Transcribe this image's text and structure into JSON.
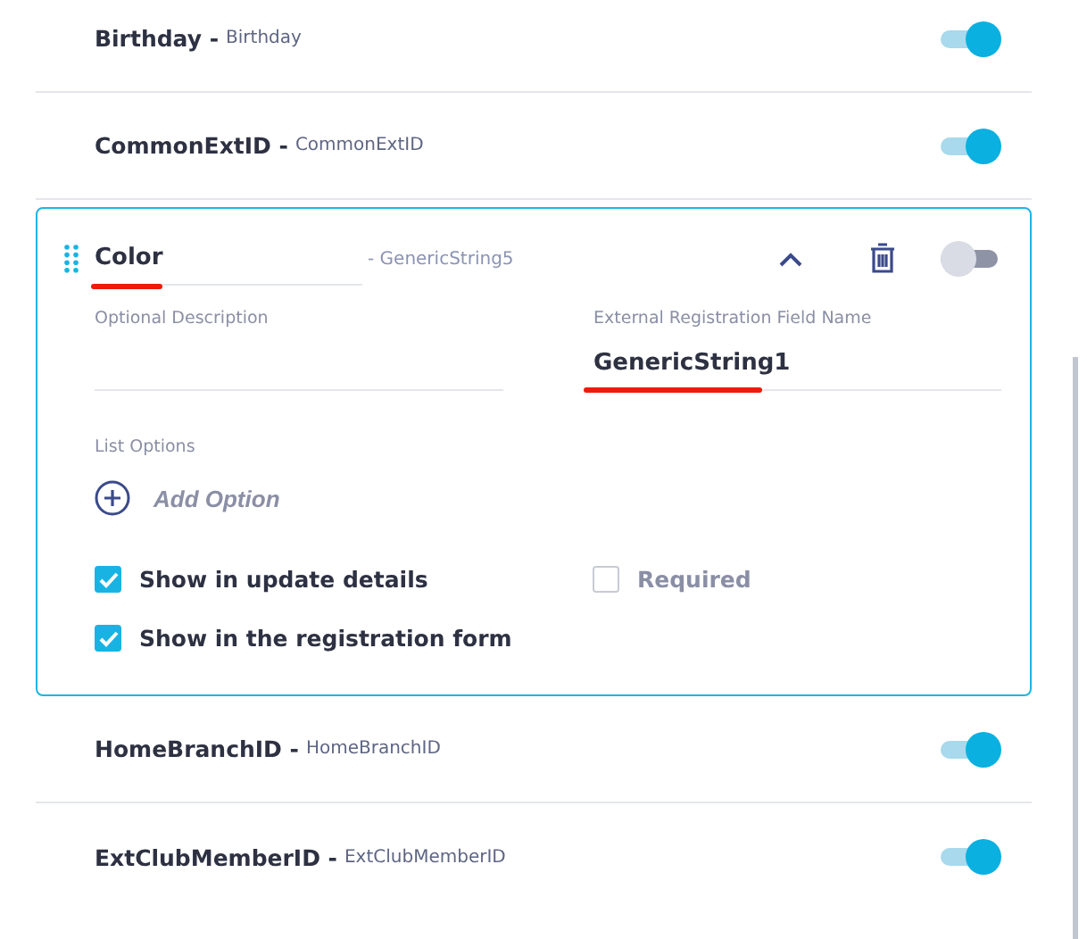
{
  "fields_before": [
    {
      "name": "Birthday -",
      "key": "Birthday",
      "enabled": true
    },
    {
      "name": "CommonExtID -",
      "key": "CommonExtID",
      "enabled": true
    }
  ],
  "expanded_field": {
    "name": "Color",
    "name_underlined": true,
    "key": "- GenericString5",
    "enabled": false,
    "description": {
      "label": "Optional Description"
    },
    "external": {
      "label": "External Registration Field Name",
      "value": "GenericString1",
      "underlined": true
    },
    "list_options": {
      "label": "List Options",
      "add_label": "Add Option"
    },
    "checkboxes": [
      {
        "label": "Show in update details",
        "checked": true
      },
      {
        "label": "Required",
        "checked": false
      },
      {
        "label": "Show in the registration form",
        "checked": true
      }
    ]
  },
  "fields_after": [
    {
      "name": "HomeBranchID -",
      "key": "HomeBranchID",
      "enabled": true
    },
    {
      "name": "ExtClubMemberID -",
      "key": "ExtClubMemberID",
      "enabled": true
    }
  ]
}
